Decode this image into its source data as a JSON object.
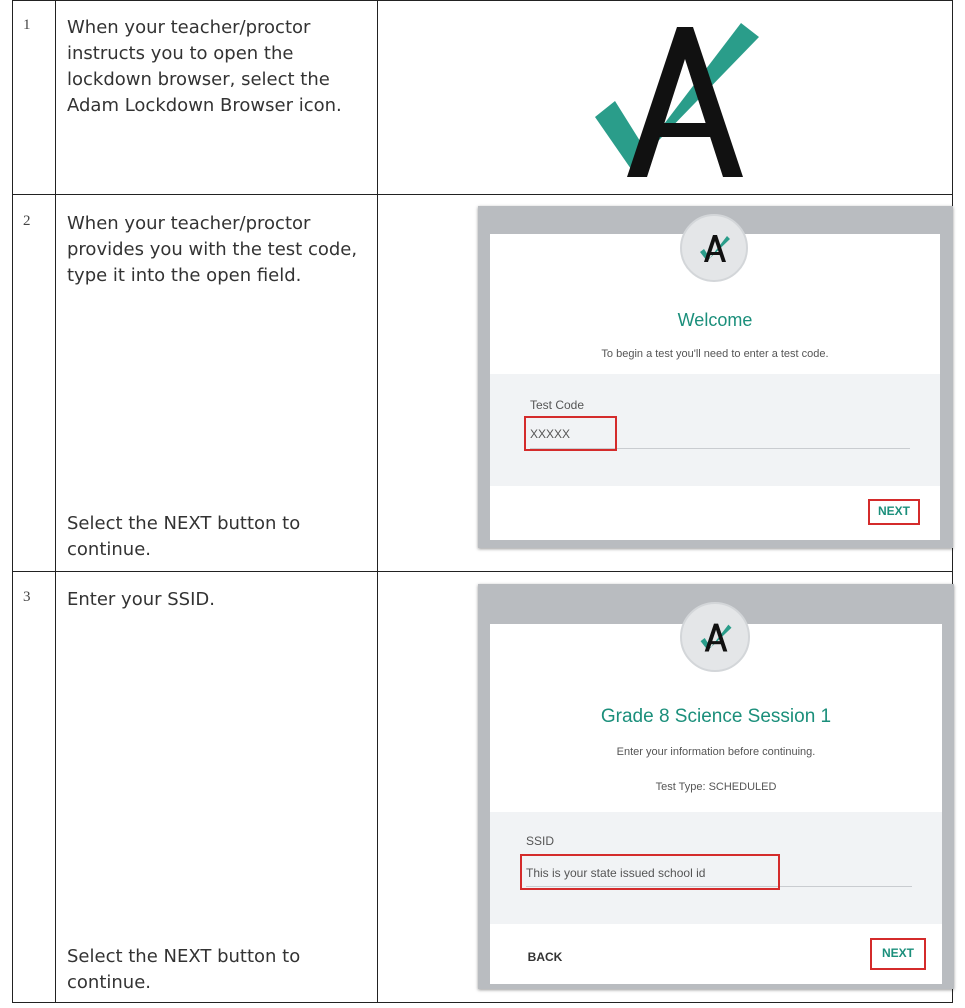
{
  "steps": [
    {
      "number": "1",
      "text": "When your teacher/proctor instructs you to open the lockdown browser, select the Adam Lockdown Browser icon."
    },
    {
      "number": "2",
      "text": "When your teacher/proctor provides you with the test code, type it into the open field.",
      "extra_text": "Select the NEXT button to continue.",
      "screen": {
        "title": "Welcome",
        "subtitle": "To begin a test you'll need to enter a test code.",
        "field_label": "Test Code",
        "field_value": "XXXXX",
        "next_label": "NEXT"
      }
    },
    {
      "number": "3",
      "text": "Enter your SSID.",
      "extra_text": "Select the NEXT button to continue.",
      "screen": {
        "title": "Grade 8 Science Session 1",
        "subtitle": "Enter your information before continuing.",
        "test_type": "Test Type: SCHEDULED",
        "field_label": "SSID",
        "field_value": "This is your state issued school id",
        "back_label": "BACK",
        "next_label": "NEXT"
      }
    }
  ],
  "colors": {
    "accent": "#1b8f7b",
    "logo_check": "#2a9d8a",
    "highlight": "#d42b2b"
  },
  "icons": [
    "adam-lockdown-logo-icon"
  ]
}
